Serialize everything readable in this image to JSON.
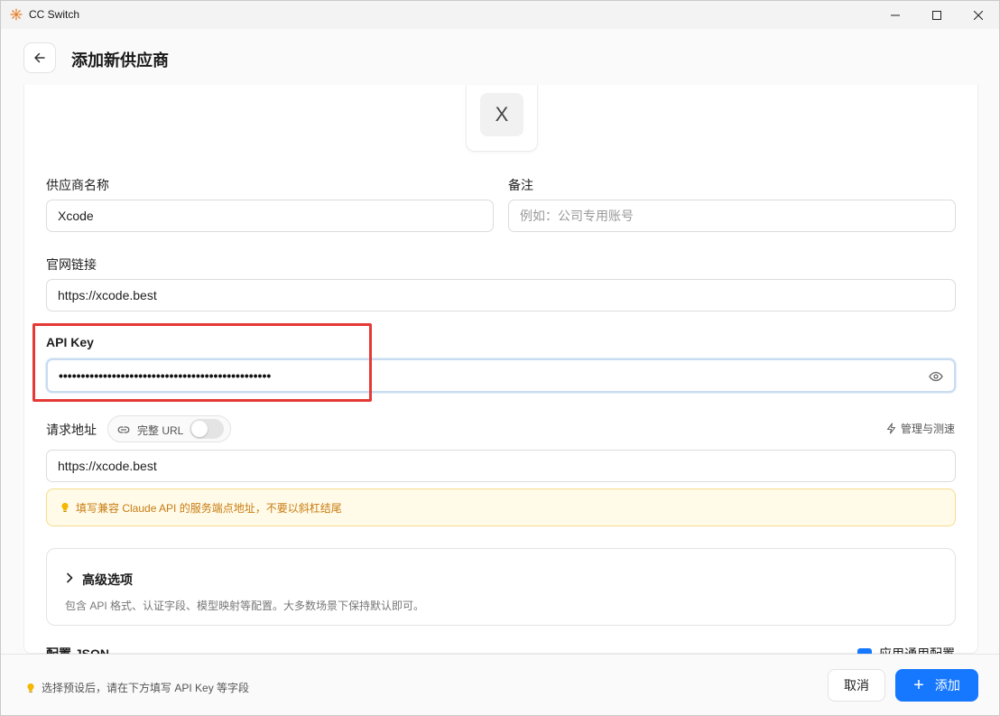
{
  "window": {
    "title": "CC Switch",
    "controls": {
      "minimize": "minimize-icon",
      "maximize": "maximize-icon",
      "close": "close-icon"
    }
  },
  "header": {
    "title": "添加新供应商",
    "back_icon": "arrow-left-icon"
  },
  "provider_icon": {
    "letter": "X"
  },
  "form": {
    "name": {
      "label": "供应商名称",
      "value": "Xcode"
    },
    "notes": {
      "label": "备注",
      "placeholder": "例如：公司专用账号"
    },
    "website": {
      "label": "官网链接",
      "value": "https://xcode.best"
    },
    "api_key": {
      "label": "API Key",
      "masked_value": "••••••••••••••••••••••••••••••••••••••••••••••••",
      "toggle_icon": "eye-icon"
    },
    "endpoint": {
      "label": "请求地址",
      "full_url_toggle": {
        "label": "完整 URL",
        "on": false
      },
      "manage_link": "管理与测速",
      "value": "https://xcode.best",
      "hint": "填写兼容 Claude API 的服务端点地址，不要以斜杠结尾"
    },
    "advanced": {
      "title": "高级选项",
      "description": "包含 API 格式、认证字段、模型映射等配置。大多数场景下保持默认即可。"
    },
    "config_json": {
      "label": "配置 JSON",
      "checkbox_label": "应用通用配置",
      "checked": true
    }
  },
  "footer": {
    "hint": "选择预设后，请在下方填写 API Key 等字段",
    "cancel_label": "取消",
    "add_label": "添加"
  },
  "colors": {
    "accent": "#1677ff",
    "highlight_box": "#e53935",
    "hint_text": "#c97b12",
    "hint_bg": "#fffbe8"
  }
}
